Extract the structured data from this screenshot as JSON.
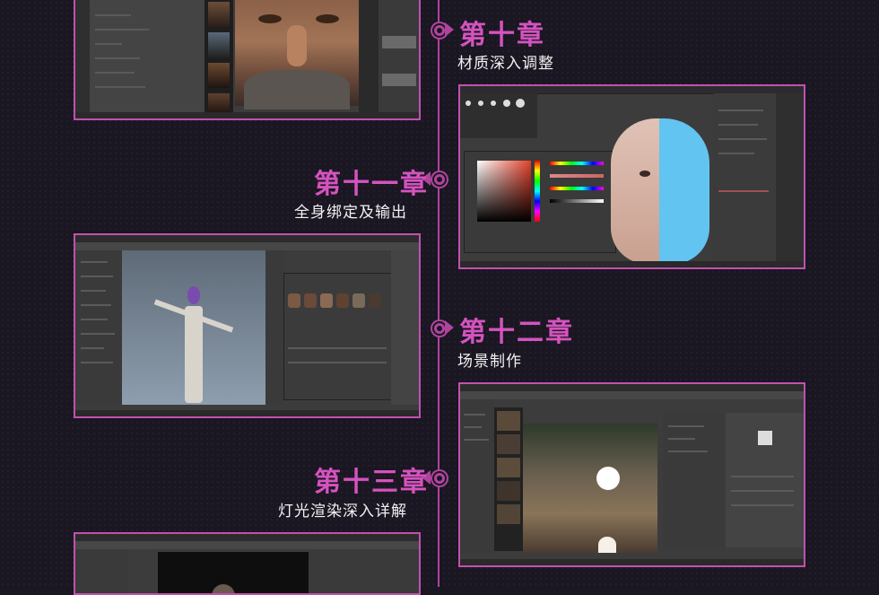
{
  "chapters": [
    {
      "title": "第十章",
      "subtitle": "材质深入调整"
    },
    {
      "title": "第十一章",
      "subtitle": "全身绑定及输出"
    },
    {
      "title": "第十二章",
      "subtitle": "场景制作"
    },
    {
      "title": "第十三章",
      "subtitle": "灯光渲染深入详解"
    }
  ],
  "colors": {
    "accent": "#d553bf",
    "frame": "#c251b0",
    "background": "#1a1622",
    "text": "#f2f2f2"
  },
  "screenshots": [
    {
      "name": "face-closeup-viewport",
      "icons": [
        "character-thumbnail-icon"
      ]
    },
    {
      "name": "color-picker-head-material",
      "icons": [
        "color-picker-icon",
        "head-model-icon"
      ]
    },
    {
      "name": "body-rig-viewport",
      "icons": [
        "skeleton-rig-icon",
        "avatar-thumbnail-icon"
      ]
    },
    {
      "name": "scene-render-viewport",
      "icons": [
        "render-sphere-icon",
        "light-icon"
      ]
    },
    {
      "name": "lighting-viewport",
      "icons": [
        "character-head-icon"
      ]
    }
  ]
}
